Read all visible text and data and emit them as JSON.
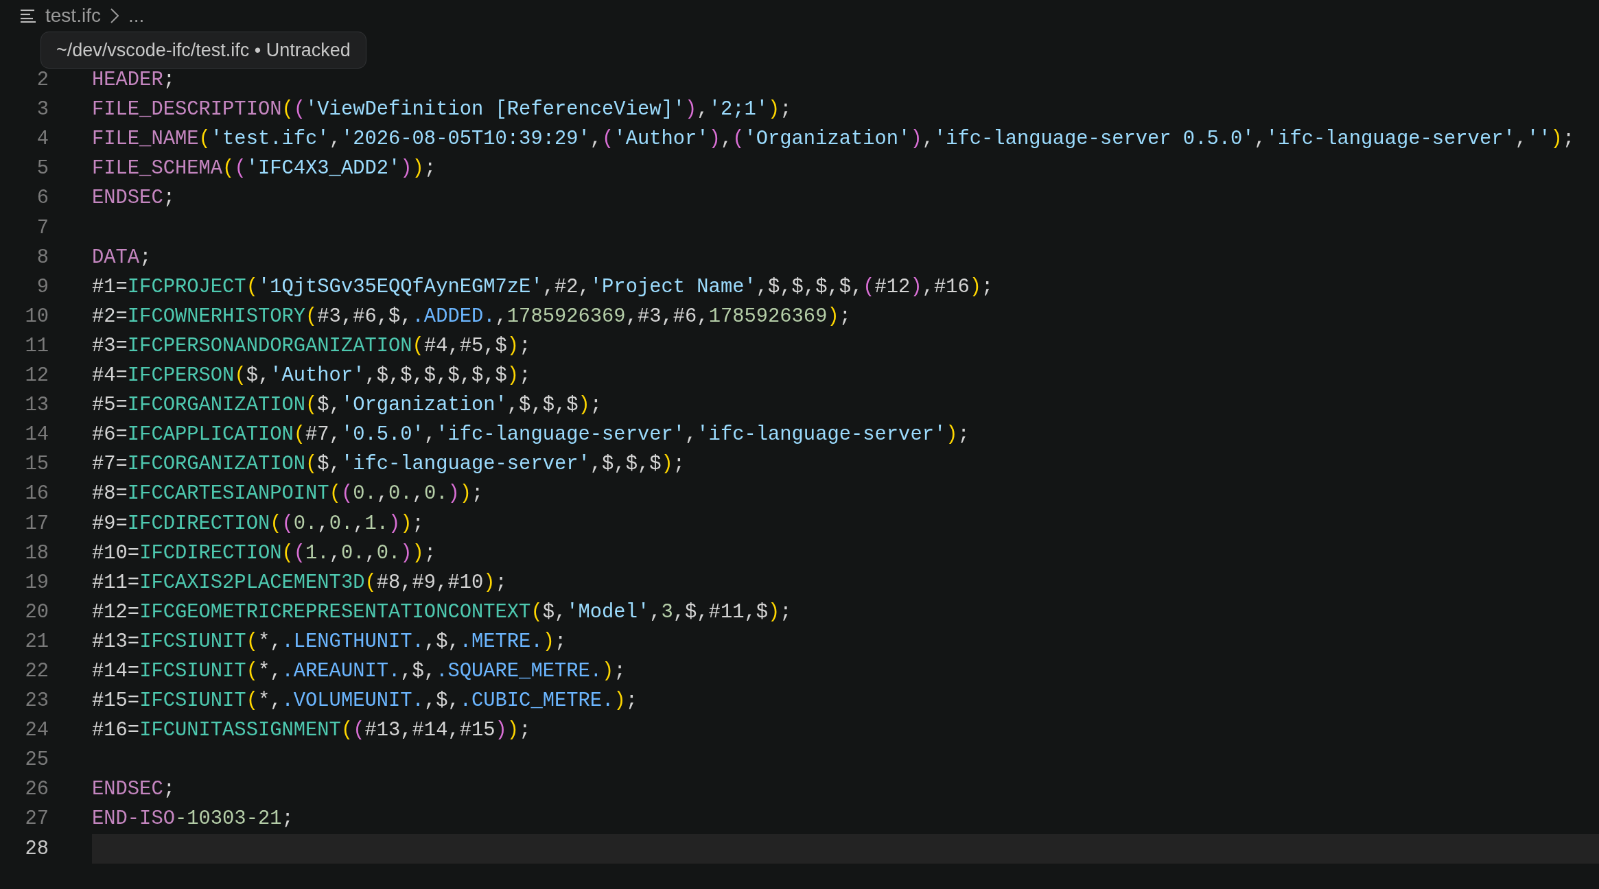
{
  "breadcrumb": {
    "file": "test.ifc",
    "more": "..."
  },
  "tooltip": {
    "text": "~/dev/vscode-ifc/test.ifc • Untracked"
  },
  "lines": [
    {
      "number": "2",
      "selected": false,
      "tokens": [
        {
          "kind": "keyword",
          "text": "HEADER"
        },
        {
          "kind": "plain",
          "text": ";"
        }
      ]
    },
    {
      "number": "3",
      "selected": false,
      "tokens": [
        {
          "kind": "keyword",
          "text": "FILE_DESCRIPTION"
        },
        {
          "kind": "paren1",
          "text": "("
        },
        {
          "kind": "paren2",
          "text": "("
        },
        {
          "kind": "string",
          "text": "'ViewDefinition [ReferenceView]'"
        },
        {
          "kind": "paren2",
          "text": ")"
        },
        {
          "kind": "plain",
          "text": ","
        },
        {
          "kind": "string",
          "text": "'2;1'"
        },
        {
          "kind": "paren1",
          "text": ")"
        },
        {
          "kind": "plain",
          "text": ";"
        }
      ]
    },
    {
      "number": "4",
      "selected": false,
      "tokens": [
        {
          "kind": "keyword",
          "text": "FILE_NAME"
        },
        {
          "kind": "paren1",
          "text": "("
        },
        {
          "kind": "string",
          "text": "'test.ifc'"
        },
        {
          "kind": "plain",
          "text": ","
        },
        {
          "kind": "string",
          "text": "'2026-08-05T10:39:29'"
        },
        {
          "kind": "plain",
          "text": ","
        },
        {
          "kind": "paren2",
          "text": "("
        },
        {
          "kind": "string",
          "text": "'Author'"
        },
        {
          "kind": "paren2",
          "text": ")"
        },
        {
          "kind": "plain",
          "text": ","
        },
        {
          "kind": "paren2",
          "text": "("
        },
        {
          "kind": "string",
          "text": "'Organization'"
        },
        {
          "kind": "paren2",
          "text": ")"
        },
        {
          "kind": "plain",
          "text": ","
        },
        {
          "kind": "string",
          "text": "'ifc-language-server 0.5.0'"
        },
        {
          "kind": "plain",
          "text": ","
        },
        {
          "kind": "string",
          "text": "'ifc-language-server'"
        },
        {
          "kind": "plain",
          "text": ","
        },
        {
          "kind": "string",
          "text": "''"
        },
        {
          "kind": "paren1",
          "text": ")"
        },
        {
          "kind": "plain",
          "text": ";"
        }
      ]
    },
    {
      "number": "5",
      "selected": false,
      "tokens": [
        {
          "kind": "keyword",
          "text": "FILE_SCHEMA"
        },
        {
          "kind": "paren1",
          "text": "("
        },
        {
          "kind": "paren2",
          "text": "("
        },
        {
          "kind": "string",
          "text": "'IFC4X3_ADD2'"
        },
        {
          "kind": "paren2",
          "text": ")"
        },
        {
          "kind": "paren1",
          "text": ")"
        },
        {
          "kind": "plain",
          "text": ";"
        }
      ]
    },
    {
      "number": "6",
      "selected": false,
      "tokens": [
        {
          "kind": "keyword",
          "text": "ENDSEC"
        },
        {
          "kind": "plain",
          "text": ";"
        }
      ]
    },
    {
      "number": "7",
      "selected": false
    },
    {
      "number": "8",
      "selected": false,
      "tokens": [
        {
          "kind": "keyword",
          "text": "DATA"
        },
        {
          "kind": "plain",
          "text": ";"
        }
      ]
    },
    {
      "number": "9",
      "selected": false,
      "tokens": [
        {
          "kind": "plain",
          "text": "#1="
        },
        {
          "kind": "entity",
          "text": "IFCPROJECT"
        },
        {
          "kind": "paren1",
          "text": "("
        },
        {
          "kind": "string",
          "text": "'1QjtSGv35EQQfAynEGM7zE'"
        },
        {
          "kind": "plain",
          "text": ",#2,"
        },
        {
          "kind": "string",
          "text": "'Project Name'"
        },
        {
          "kind": "plain",
          "text": ",$,$,$,$,"
        },
        {
          "kind": "paren2",
          "text": "("
        },
        {
          "kind": "plain",
          "text": "#12"
        },
        {
          "kind": "paren2",
          "text": ")"
        },
        {
          "kind": "plain",
          "text": ",#16"
        },
        {
          "kind": "paren1",
          "text": ")"
        },
        {
          "kind": "plain",
          "text": ";"
        }
      ]
    },
    {
      "number": "10",
      "selected": false,
      "tokens": [
        {
          "kind": "plain",
          "text": "#2="
        },
        {
          "kind": "entity",
          "text": "IFCOWNERHISTORY"
        },
        {
          "kind": "paren1",
          "text": "("
        },
        {
          "kind": "plain",
          "text": "#3,#6,$,"
        },
        {
          "kind": "enum",
          "text": ".ADDED."
        },
        {
          "kind": "plain",
          "text": ","
        },
        {
          "kind": "number",
          "text": "1785926369"
        },
        {
          "kind": "plain",
          "text": ",#3,#6,"
        },
        {
          "kind": "number",
          "text": "1785926369"
        },
        {
          "kind": "paren1",
          "text": ")"
        },
        {
          "kind": "plain",
          "text": ";"
        }
      ]
    },
    {
      "number": "11",
      "selected": false,
      "tokens": [
        {
          "kind": "plain",
          "text": "#3="
        },
        {
          "kind": "entity",
          "text": "IFCPERSONANDORGANIZATION"
        },
        {
          "kind": "paren1",
          "text": "("
        },
        {
          "kind": "plain",
          "text": "#4,#5,$"
        },
        {
          "kind": "paren1",
          "text": ")"
        },
        {
          "kind": "plain",
          "text": ";"
        }
      ]
    },
    {
      "number": "12",
      "selected": false,
      "tokens": [
        {
          "kind": "plain",
          "text": "#4="
        },
        {
          "kind": "entity",
          "text": "IFCPERSON"
        },
        {
          "kind": "paren1",
          "text": "("
        },
        {
          "kind": "plain",
          "text": "$,"
        },
        {
          "kind": "string",
          "text": "'Author'"
        },
        {
          "kind": "plain",
          "text": ",$,$,$,$,$,$"
        },
        {
          "kind": "paren1",
          "text": ")"
        },
        {
          "kind": "plain",
          "text": ";"
        }
      ]
    },
    {
      "number": "13",
      "selected": false,
      "tokens": [
        {
          "kind": "plain",
          "text": "#5="
        },
        {
          "kind": "entity",
          "text": "IFCORGANIZATION"
        },
        {
          "kind": "paren1",
          "text": "("
        },
        {
          "kind": "plain",
          "text": "$,"
        },
        {
          "kind": "string",
          "text": "'Organization'"
        },
        {
          "kind": "plain",
          "text": ",$,$,$"
        },
        {
          "kind": "paren1",
          "text": ")"
        },
        {
          "kind": "plain",
          "text": ";"
        }
      ]
    },
    {
      "number": "14",
      "selected": false,
      "tokens": [
        {
          "kind": "plain",
          "text": "#6="
        },
        {
          "kind": "entity",
          "text": "IFCAPPLICATION"
        },
        {
          "kind": "paren1",
          "text": "("
        },
        {
          "kind": "plain",
          "text": "#7,"
        },
        {
          "kind": "string",
          "text": "'0.5.0'"
        },
        {
          "kind": "plain",
          "text": ","
        },
        {
          "kind": "string",
          "text": "'ifc-language-server'"
        },
        {
          "kind": "plain",
          "text": ","
        },
        {
          "kind": "string",
          "text": "'ifc-language-server'"
        },
        {
          "kind": "paren1",
          "text": ")"
        },
        {
          "kind": "plain",
          "text": ";"
        }
      ]
    },
    {
      "number": "15",
      "selected": false,
      "tokens": [
        {
          "kind": "plain",
          "text": "#7="
        },
        {
          "kind": "entity",
          "text": "IFCORGANIZATION"
        },
        {
          "kind": "paren1",
          "text": "("
        },
        {
          "kind": "plain",
          "text": "$,"
        },
        {
          "kind": "string",
          "text": "'ifc-language-server'"
        },
        {
          "kind": "plain",
          "text": ",$,$,$"
        },
        {
          "kind": "paren1",
          "text": ")"
        },
        {
          "kind": "plain",
          "text": ";"
        }
      ]
    },
    {
      "number": "16",
      "selected": false,
      "tokens": [
        {
          "kind": "plain",
          "text": "#8="
        },
        {
          "kind": "entity",
          "text": "IFCCARTESIANPOINT"
        },
        {
          "kind": "paren1",
          "text": "("
        },
        {
          "kind": "paren2",
          "text": "("
        },
        {
          "kind": "number",
          "text": "0."
        },
        {
          "kind": "plain",
          "text": ","
        },
        {
          "kind": "number",
          "text": "0."
        },
        {
          "kind": "plain",
          "text": ","
        },
        {
          "kind": "number",
          "text": "0."
        },
        {
          "kind": "paren2",
          "text": ")"
        },
        {
          "kind": "paren1",
          "text": ")"
        },
        {
          "kind": "plain",
          "text": ";"
        }
      ]
    },
    {
      "number": "17",
      "selected": false,
      "tokens": [
        {
          "kind": "plain",
          "text": "#9="
        },
        {
          "kind": "entity",
          "text": "IFCDIRECTION"
        },
        {
          "kind": "paren1",
          "text": "("
        },
        {
          "kind": "paren2",
          "text": "("
        },
        {
          "kind": "number",
          "text": "0."
        },
        {
          "kind": "plain",
          "text": ","
        },
        {
          "kind": "number",
          "text": "0."
        },
        {
          "kind": "plain",
          "text": ","
        },
        {
          "kind": "number",
          "text": "1."
        },
        {
          "kind": "paren2",
          "text": ")"
        },
        {
          "kind": "paren1",
          "text": ")"
        },
        {
          "kind": "plain",
          "text": ";"
        }
      ]
    },
    {
      "number": "18",
      "selected": false,
      "tokens": [
        {
          "kind": "plain",
          "text": "#10="
        },
        {
          "kind": "entity",
          "text": "IFCDIRECTION"
        },
        {
          "kind": "paren1",
          "text": "("
        },
        {
          "kind": "paren2",
          "text": "("
        },
        {
          "kind": "number",
          "text": "1."
        },
        {
          "kind": "plain",
          "text": ","
        },
        {
          "kind": "number",
          "text": "0."
        },
        {
          "kind": "plain",
          "text": ","
        },
        {
          "kind": "number",
          "text": "0."
        },
        {
          "kind": "paren2",
          "text": ")"
        },
        {
          "kind": "paren1",
          "text": ")"
        },
        {
          "kind": "plain",
          "text": ";"
        }
      ]
    },
    {
      "number": "19",
      "selected": false,
      "tokens": [
        {
          "kind": "plain",
          "text": "#11="
        },
        {
          "kind": "entity",
          "text": "IFCAXIS2PLACEMENT3D"
        },
        {
          "kind": "paren1",
          "text": "("
        },
        {
          "kind": "plain",
          "text": "#8,#9,#10"
        },
        {
          "kind": "paren1",
          "text": ")"
        },
        {
          "kind": "plain",
          "text": ";"
        }
      ]
    },
    {
      "number": "20",
      "selected": false,
      "tokens": [
        {
          "kind": "plain",
          "text": "#12="
        },
        {
          "kind": "entity",
          "text": "IFCGEOMETRICREPRESENTATIONCONTEXT"
        },
        {
          "kind": "paren1",
          "text": "("
        },
        {
          "kind": "plain",
          "text": "$,"
        },
        {
          "kind": "string",
          "text": "'Model'"
        },
        {
          "kind": "plain",
          "text": ","
        },
        {
          "kind": "number",
          "text": "3"
        },
        {
          "kind": "plain",
          "text": ",$,#11,$"
        },
        {
          "kind": "paren1",
          "text": ")"
        },
        {
          "kind": "plain",
          "text": ";"
        }
      ]
    },
    {
      "number": "21",
      "selected": false,
      "tokens": [
        {
          "kind": "plain",
          "text": "#13="
        },
        {
          "kind": "entity",
          "text": "IFCSIUNIT"
        },
        {
          "kind": "paren1",
          "text": "("
        },
        {
          "kind": "plain",
          "text": "*,"
        },
        {
          "kind": "enum",
          "text": ".LENGTHUNIT."
        },
        {
          "kind": "plain",
          "text": ",$,"
        },
        {
          "kind": "enum",
          "text": ".METRE."
        },
        {
          "kind": "paren1",
          "text": ")"
        },
        {
          "kind": "plain",
          "text": ";"
        }
      ]
    },
    {
      "number": "22",
      "selected": false,
      "tokens": [
        {
          "kind": "plain",
          "text": "#14="
        },
        {
          "kind": "entity",
          "text": "IFCSIUNIT"
        },
        {
          "kind": "paren1",
          "text": "("
        },
        {
          "kind": "plain",
          "text": "*,"
        },
        {
          "kind": "enum",
          "text": ".AREAUNIT."
        },
        {
          "kind": "plain",
          "text": ",$,"
        },
        {
          "kind": "enum",
          "text": ".SQUARE_METRE."
        },
        {
          "kind": "paren1",
          "text": ")"
        },
        {
          "kind": "plain",
          "text": ";"
        }
      ]
    },
    {
      "number": "23",
      "selected": false,
      "tokens": [
        {
          "kind": "plain",
          "text": "#15="
        },
        {
          "kind": "entity",
          "text": "IFCSIUNIT"
        },
        {
          "kind": "paren1",
          "text": "("
        },
        {
          "kind": "plain",
          "text": "*,"
        },
        {
          "kind": "enum",
          "text": ".VOLUMEUNIT."
        },
        {
          "kind": "plain",
          "text": ",$,"
        },
        {
          "kind": "enum",
          "text": ".CUBIC_METRE."
        },
        {
          "kind": "paren1",
          "text": ")"
        },
        {
          "kind": "plain",
          "text": ";"
        }
      ]
    },
    {
      "number": "24",
      "selected": false,
      "tokens": [
        {
          "kind": "plain",
          "text": "#16="
        },
        {
          "kind": "entity",
          "text": "IFCUNITASSIGNMENT"
        },
        {
          "kind": "paren1",
          "text": "("
        },
        {
          "kind": "paren2",
          "text": "("
        },
        {
          "kind": "plain",
          "text": "#13,#14,#15"
        },
        {
          "kind": "paren2",
          "text": ")"
        },
        {
          "kind": "paren1",
          "text": ")"
        },
        {
          "kind": "plain",
          "text": ";"
        }
      ]
    },
    {
      "number": "25",
      "selected": false
    },
    {
      "number": "26",
      "selected": false,
      "tokens": [
        {
          "kind": "keyword",
          "text": "ENDSEC"
        },
        {
          "kind": "plain",
          "text": ";"
        }
      ]
    },
    {
      "number": "27",
      "selected": false,
      "tokens": [
        {
          "kind": "keyword",
          "text": "END-ISO"
        },
        {
          "kind": "number",
          "text": "-10303-21"
        },
        {
          "kind": "plain",
          "text": ";"
        }
      ]
    },
    {
      "number": "28",
      "selected": true
    }
  ]
}
